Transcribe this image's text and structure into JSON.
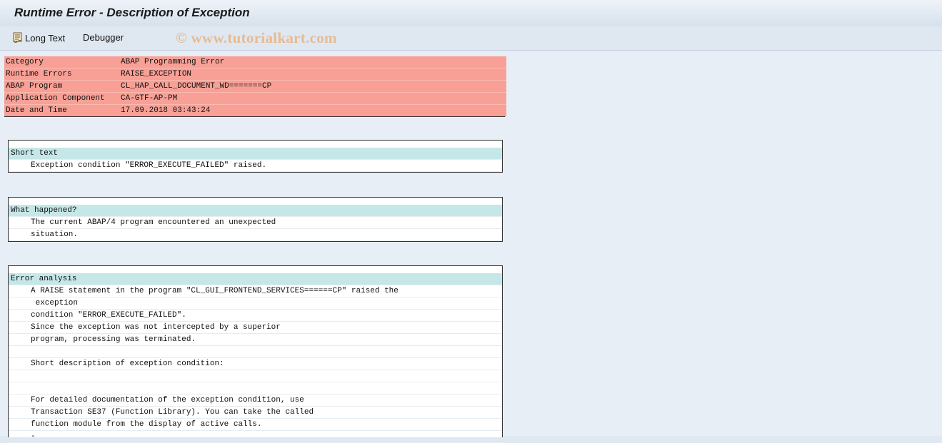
{
  "window": {
    "title": "Runtime Error - Description of Exception"
  },
  "toolbar": {
    "long_text_label": "Long Text",
    "debugger_label": "Debugger"
  },
  "watermark": "© www.tutorialkart.com",
  "header": {
    "rows": [
      {
        "key": "Category",
        "value": "ABAP Programming Error"
      },
      {
        "key": "Runtime Errors",
        "value": "RAISE_EXCEPTION"
      },
      {
        "key": "ABAP Program",
        "value": "CL_HAP_CALL_DOCUMENT_WD=======CP"
      },
      {
        "key": "Application Component",
        "value": "CA-GTF-AP-PM"
      },
      {
        "key": "Date and Time",
        "value": "17.09.2018 03:43:24"
      }
    ]
  },
  "short_text": {
    "heading": "Short text",
    "lines": [
      "Exception condition \"ERROR_EXECUTE_FAILED\" raised."
    ]
  },
  "what_happened": {
    "heading": "What happened?",
    "lines": [
      "The current ABAP/4 program encountered an unexpected",
      "situation."
    ]
  },
  "error_analysis": {
    "heading": "Error analysis",
    "lines": [
      "A RAISE statement in the program \"CL_GUI_FRONTEND_SERVICES======CP\" raised the",
      " exception",
      "condition \"ERROR_EXECUTE_FAILED\".",
      "Since the exception was not intercepted by a superior",
      "program, processing was terminated.",
      "",
      "Short description of exception condition:",
      "",
      "",
      "For detailed documentation of the exception condition, use",
      "Transaction SE37 (Function Library). You can take the called",
      "function module from the display of active calls.",
      "-"
    ]
  }
}
